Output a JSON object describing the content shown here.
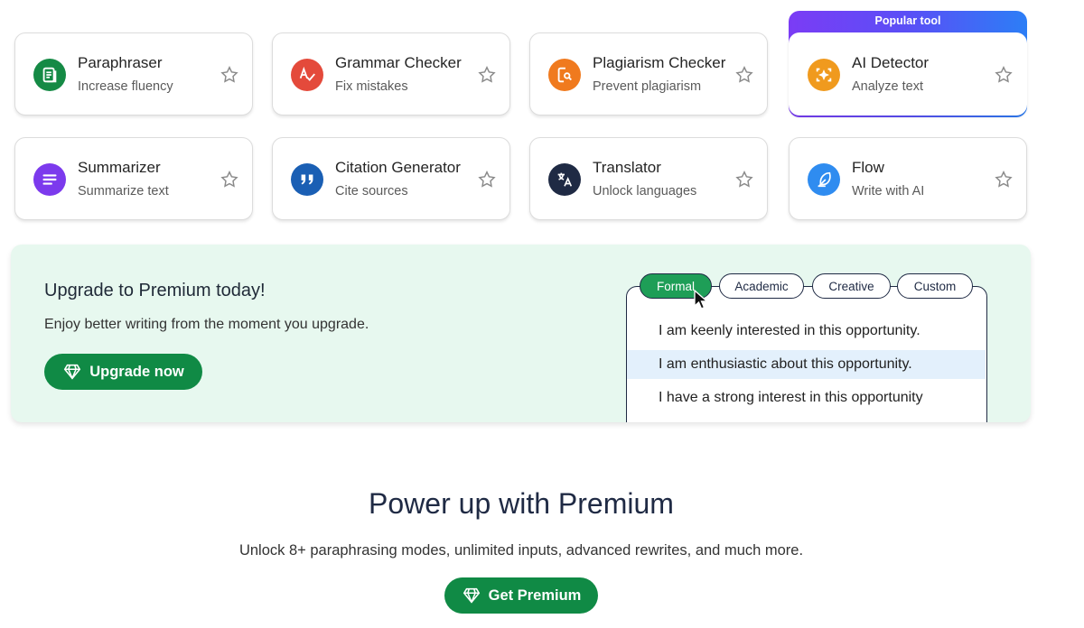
{
  "tools": [
    {
      "title": "Paraphraser",
      "subtitle": "Increase fluency",
      "icon": "paraphraser-icon",
      "color": "#158a45"
    },
    {
      "title": "Grammar Checker",
      "subtitle": "Fix mistakes",
      "icon": "grammar-check-icon",
      "color": "#e44a3b"
    },
    {
      "title": "Plagiarism Checker",
      "subtitle": "Prevent plagiarism",
      "icon": "plagiarism-icon",
      "color": "#f07a1e"
    },
    {
      "title": "AI Detector",
      "subtitle": "Analyze text",
      "icon": "ai-detector-icon",
      "color": "#f09a1e"
    },
    {
      "title": "Summarizer",
      "subtitle": "Summarize text",
      "icon": "summarizer-icon",
      "color": "#7c3aed"
    },
    {
      "title": "Citation Generator",
      "subtitle": "Cite sources",
      "icon": "citation-icon",
      "color": "#1a5fb4"
    },
    {
      "title": "Translator",
      "subtitle": "Unlock languages",
      "icon": "translator-icon",
      "color": "#1f2a44"
    },
    {
      "title": "Flow",
      "subtitle": "Write with AI",
      "icon": "flow-feather-icon",
      "color": "#2f8cf0"
    }
  ],
  "popular_label": "Popular tool",
  "banner": {
    "title": "Upgrade to Premium today!",
    "subtitle": "Enjoy better writing from the moment you upgrade.",
    "button": "Upgrade now",
    "modes": [
      "Formal",
      "Academic",
      "Creative",
      "Custom"
    ],
    "active_mode": "Formal",
    "sentences": [
      "I am keenly interested in this opportunity.",
      "I am enthusiastic about this opportunity.",
      "I have a strong interest in this opportunity"
    ]
  },
  "promo": {
    "title": "Power up with Premium",
    "subtitle": "Unlock 8+ paraphrasing modes, unlimited inputs, advanced rewrites, and much more.",
    "button": "Get Premium"
  },
  "colors": {
    "brand_green": "#108a45",
    "banner_bg": "#e7f8ef",
    "highlight": "#e3f0fc"
  }
}
